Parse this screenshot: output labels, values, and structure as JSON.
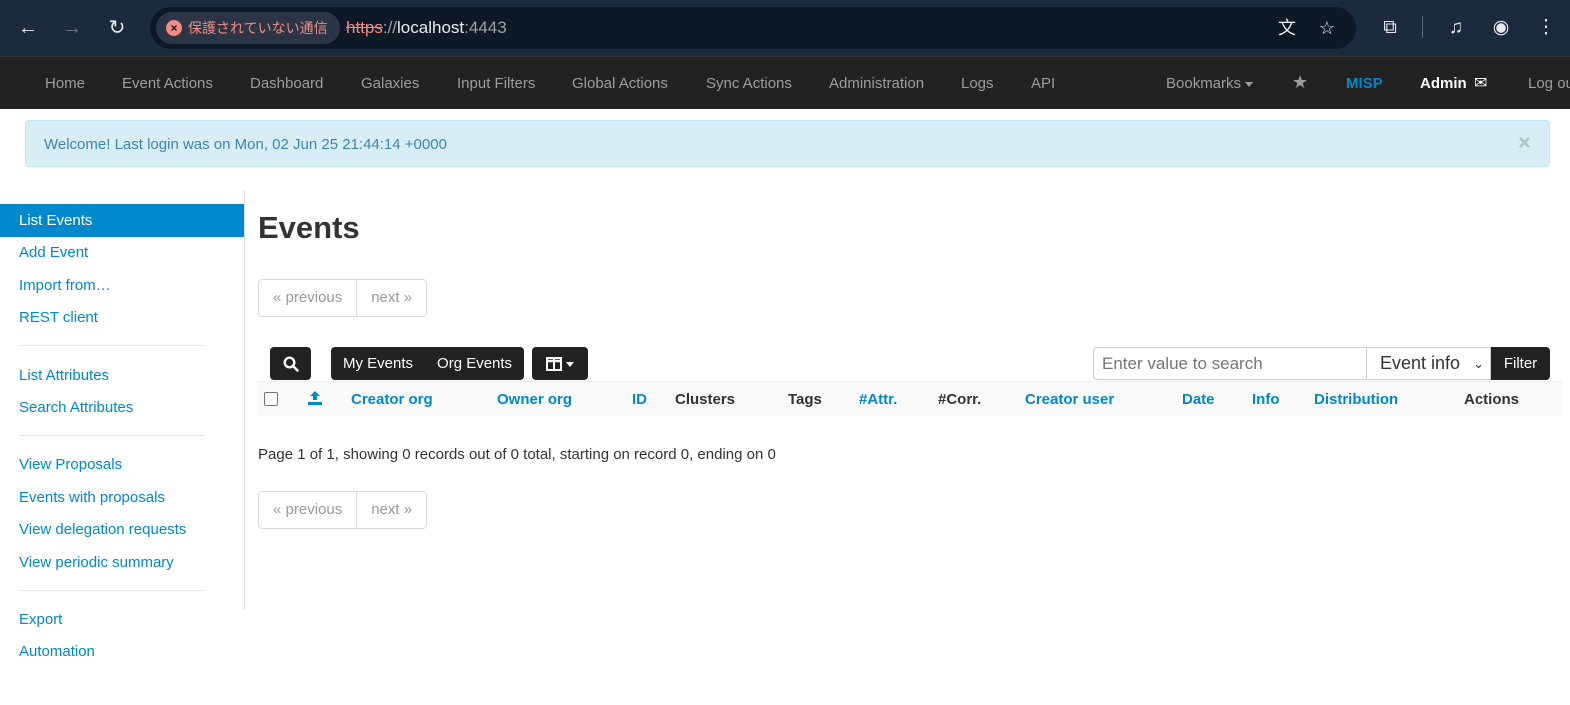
{
  "browser": {
    "security_label": "保護されていない通信",
    "url_protocol": "https",
    "url_separator": "://",
    "url_host": "localhost",
    "url_port": ":4443"
  },
  "topnav": {
    "items": [
      "Home",
      "Event Actions",
      "Dashboard",
      "Galaxies",
      "Input Filters",
      "Global Actions",
      "Sync Actions",
      "Administration",
      "Logs",
      "API"
    ],
    "bookmarks": "Bookmarks",
    "misp": "MISP",
    "admin": "Admin",
    "logout": "Log out"
  },
  "alert": {
    "message": "Welcome! Last login was on Mon, 02 Jun 25 21:44:14 +0000",
    "close": "×"
  },
  "sidebar": {
    "items": [
      {
        "label": "List Events"
      },
      {
        "label": "Add Event"
      },
      {
        "label": "Import from…"
      },
      {
        "label": "REST client"
      },
      {
        "label": "List Attributes"
      },
      {
        "label": "Search Attributes"
      },
      {
        "label": "View Proposals"
      },
      {
        "label": "Events with proposals"
      },
      {
        "label": "View delegation requests"
      },
      {
        "label": "View periodic summary"
      },
      {
        "label": "Export"
      },
      {
        "label": "Automation"
      }
    ]
  },
  "main": {
    "title": "Events",
    "pager": {
      "previous": "« previous",
      "next": "next »"
    },
    "filters": {
      "my_events": "My Events",
      "org_events": "Org Events"
    },
    "search": {
      "placeholder": "Enter value to search",
      "field": "Event info",
      "button": "Filter"
    },
    "columns": [
      "Creator org",
      "Owner org",
      "ID",
      "Clusters",
      "Tags",
      "#Attr.",
      "#Corr.",
      "Creator user",
      "Date",
      "Info",
      "Distribution",
      "Actions"
    ],
    "page_info": "Page 1 of 1, showing 0 records out of 0 total, starting on record 0, ending on 0"
  },
  "colors": {
    "accent": "#0088cc",
    "navbar": "#222222",
    "alert_bg": "#d9edf7"
  }
}
